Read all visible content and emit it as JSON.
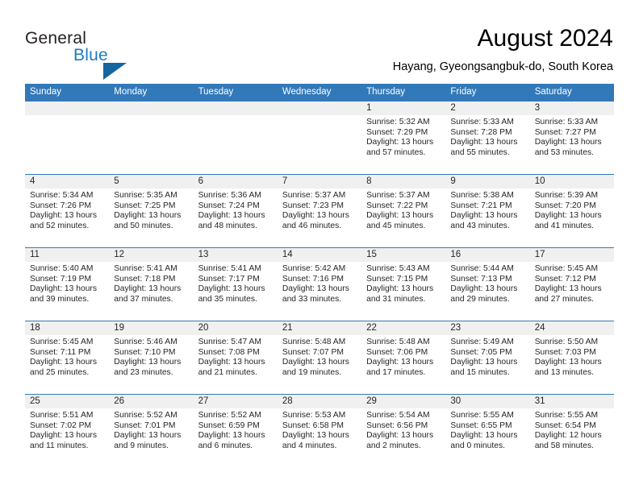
{
  "brand": {
    "name_part1": "General",
    "name_part2": "Blue",
    "triangle_color": "#15659f",
    "blue_color": "#1c7bc4"
  },
  "header": {
    "title": "August 2024",
    "location": "Hayang, Gyeongsangbuk-do, South Korea"
  },
  "theme": {
    "header_bar_color": "#3279b9",
    "day_strip_color": "#f0f0f0",
    "row_divider_color": "#3279b9",
    "text_color": "#262626"
  },
  "weekday_headers": [
    "Sunday",
    "Monday",
    "Tuesday",
    "Wednesday",
    "Thursday",
    "Friday",
    "Saturday"
  ],
  "labels": {
    "sunrise_prefix": "Sunrise:",
    "sunset_prefix": "Sunset:",
    "daylight_prefix": "Daylight:"
  },
  "weeks": [
    [
      {
        "day": "",
        "empty": true
      },
      {
        "day": "",
        "empty": true
      },
      {
        "day": "",
        "empty": true
      },
      {
        "day": "",
        "empty": true
      },
      {
        "day": "1",
        "sunrise": "Sunrise: 5:32 AM",
        "sunset": "Sunset: 7:29 PM",
        "daylight_l1": "Daylight: 13 hours",
        "daylight_l2": "and 57 minutes."
      },
      {
        "day": "2",
        "sunrise": "Sunrise: 5:33 AM",
        "sunset": "Sunset: 7:28 PM",
        "daylight_l1": "Daylight: 13 hours",
        "daylight_l2": "and 55 minutes."
      },
      {
        "day": "3",
        "sunrise": "Sunrise: 5:33 AM",
        "sunset": "Sunset: 7:27 PM",
        "daylight_l1": "Daylight: 13 hours",
        "daylight_l2": "and 53 minutes."
      }
    ],
    [
      {
        "day": "4",
        "sunrise": "Sunrise: 5:34 AM",
        "sunset": "Sunset: 7:26 PM",
        "daylight_l1": "Daylight: 13 hours",
        "daylight_l2": "and 52 minutes."
      },
      {
        "day": "5",
        "sunrise": "Sunrise: 5:35 AM",
        "sunset": "Sunset: 7:25 PM",
        "daylight_l1": "Daylight: 13 hours",
        "daylight_l2": "and 50 minutes."
      },
      {
        "day": "6",
        "sunrise": "Sunrise: 5:36 AM",
        "sunset": "Sunset: 7:24 PM",
        "daylight_l1": "Daylight: 13 hours",
        "daylight_l2": "and 48 minutes."
      },
      {
        "day": "7",
        "sunrise": "Sunrise: 5:37 AM",
        "sunset": "Sunset: 7:23 PM",
        "daylight_l1": "Daylight: 13 hours",
        "daylight_l2": "and 46 minutes."
      },
      {
        "day": "8",
        "sunrise": "Sunrise: 5:37 AM",
        "sunset": "Sunset: 7:22 PM",
        "daylight_l1": "Daylight: 13 hours",
        "daylight_l2": "and 45 minutes."
      },
      {
        "day": "9",
        "sunrise": "Sunrise: 5:38 AM",
        "sunset": "Sunset: 7:21 PM",
        "daylight_l1": "Daylight: 13 hours",
        "daylight_l2": "and 43 minutes."
      },
      {
        "day": "10",
        "sunrise": "Sunrise: 5:39 AM",
        "sunset": "Sunset: 7:20 PM",
        "daylight_l1": "Daylight: 13 hours",
        "daylight_l2": "and 41 minutes."
      }
    ],
    [
      {
        "day": "11",
        "sunrise": "Sunrise: 5:40 AM",
        "sunset": "Sunset: 7:19 PM",
        "daylight_l1": "Daylight: 13 hours",
        "daylight_l2": "and 39 minutes."
      },
      {
        "day": "12",
        "sunrise": "Sunrise: 5:41 AM",
        "sunset": "Sunset: 7:18 PM",
        "daylight_l1": "Daylight: 13 hours",
        "daylight_l2": "and 37 minutes."
      },
      {
        "day": "13",
        "sunrise": "Sunrise: 5:41 AM",
        "sunset": "Sunset: 7:17 PM",
        "daylight_l1": "Daylight: 13 hours",
        "daylight_l2": "and 35 minutes."
      },
      {
        "day": "14",
        "sunrise": "Sunrise: 5:42 AM",
        "sunset": "Sunset: 7:16 PM",
        "daylight_l1": "Daylight: 13 hours",
        "daylight_l2": "and 33 minutes."
      },
      {
        "day": "15",
        "sunrise": "Sunrise: 5:43 AM",
        "sunset": "Sunset: 7:15 PM",
        "daylight_l1": "Daylight: 13 hours",
        "daylight_l2": "and 31 minutes."
      },
      {
        "day": "16",
        "sunrise": "Sunrise: 5:44 AM",
        "sunset": "Sunset: 7:13 PM",
        "daylight_l1": "Daylight: 13 hours",
        "daylight_l2": "and 29 minutes."
      },
      {
        "day": "17",
        "sunrise": "Sunrise: 5:45 AM",
        "sunset": "Sunset: 7:12 PM",
        "daylight_l1": "Daylight: 13 hours",
        "daylight_l2": "and 27 minutes."
      }
    ],
    [
      {
        "day": "18",
        "sunrise": "Sunrise: 5:45 AM",
        "sunset": "Sunset: 7:11 PM",
        "daylight_l1": "Daylight: 13 hours",
        "daylight_l2": "and 25 minutes."
      },
      {
        "day": "19",
        "sunrise": "Sunrise: 5:46 AM",
        "sunset": "Sunset: 7:10 PM",
        "daylight_l1": "Daylight: 13 hours",
        "daylight_l2": "and 23 minutes."
      },
      {
        "day": "20",
        "sunrise": "Sunrise: 5:47 AM",
        "sunset": "Sunset: 7:08 PM",
        "daylight_l1": "Daylight: 13 hours",
        "daylight_l2": "and 21 minutes."
      },
      {
        "day": "21",
        "sunrise": "Sunrise: 5:48 AM",
        "sunset": "Sunset: 7:07 PM",
        "daylight_l1": "Daylight: 13 hours",
        "daylight_l2": "and 19 minutes."
      },
      {
        "day": "22",
        "sunrise": "Sunrise: 5:48 AM",
        "sunset": "Sunset: 7:06 PM",
        "daylight_l1": "Daylight: 13 hours",
        "daylight_l2": "and 17 minutes."
      },
      {
        "day": "23",
        "sunrise": "Sunrise: 5:49 AM",
        "sunset": "Sunset: 7:05 PM",
        "daylight_l1": "Daylight: 13 hours",
        "daylight_l2": "and 15 minutes."
      },
      {
        "day": "24",
        "sunrise": "Sunrise: 5:50 AM",
        "sunset": "Sunset: 7:03 PM",
        "daylight_l1": "Daylight: 13 hours",
        "daylight_l2": "and 13 minutes."
      }
    ],
    [
      {
        "day": "25",
        "sunrise": "Sunrise: 5:51 AM",
        "sunset": "Sunset: 7:02 PM",
        "daylight_l1": "Daylight: 13 hours",
        "daylight_l2": "and 11 minutes."
      },
      {
        "day": "26",
        "sunrise": "Sunrise: 5:52 AM",
        "sunset": "Sunset: 7:01 PM",
        "daylight_l1": "Daylight: 13 hours",
        "daylight_l2": "and 9 minutes."
      },
      {
        "day": "27",
        "sunrise": "Sunrise: 5:52 AM",
        "sunset": "Sunset: 6:59 PM",
        "daylight_l1": "Daylight: 13 hours",
        "daylight_l2": "and 6 minutes."
      },
      {
        "day": "28",
        "sunrise": "Sunrise: 5:53 AM",
        "sunset": "Sunset: 6:58 PM",
        "daylight_l1": "Daylight: 13 hours",
        "daylight_l2": "and 4 minutes."
      },
      {
        "day": "29",
        "sunrise": "Sunrise: 5:54 AM",
        "sunset": "Sunset: 6:56 PM",
        "daylight_l1": "Daylight: 13 hours",
        "daylight_l2": "and 2 minutes."
      },
      {
        "day": "30",
        "sunrise": "Sunrise: 5:55 AM",
        "sunset": "Sunset: 6:55 PM",
        "daylight_l1": "Daylight: 13 hours",
        "daylight_l2": "and 0 minutes."
      },
      {
        "day": "31",
        "sunrise": "Sunrise: 5:55 AM",
        "sunset": "Sunset: 6:54 PM",
        "daylight_l1": "Daylight: 12 hours",
        "daylight_l2": "and 58 minutes."
      }
    ]
  ]
}
